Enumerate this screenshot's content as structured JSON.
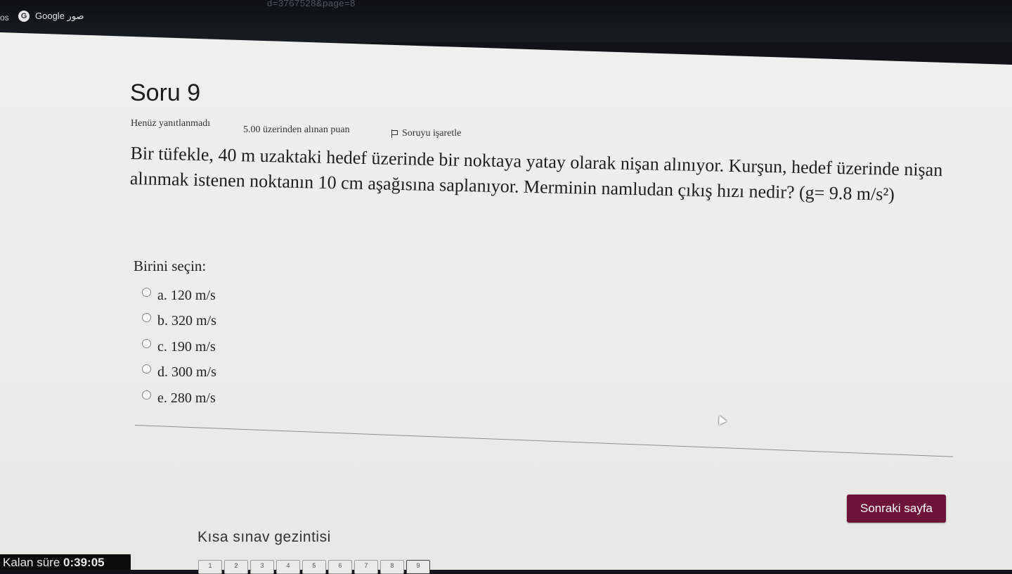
{
  "browser": {
    "url_fragment": "d=3767528&page=8",
    "tab_fragment": "os",
    "bookmark_label": "Google صور",
    "bookmark_icon": "google-icon"
  },
  "quiz": {
    "title": "Soru 9",
    "status": "Henüz yanıtlanmadı",
    "points": "5.00 üzerinden alınan puan",
    "flag_label": "Soruyu işaretle",
    "question_text": "Bir tüfekle, 40 m uzaktaki hedef üzerinde bir noktaya yatay olarak nişan alınıyor. Kurşun, hedef üzerinde nişan alınmak istenen noktanın 10 cm aşağısına saplanıyor. Merminin namludan çıkış hızı nedir? (g= 9.8 m/s²)",
    "choose_label": "Birini seçin:",
    "options": [
      {
        "label": "a. 120 m/s"
      },
      {
        "label": "b. 320 m/s"
      },
      {
        "label": "c. 190 m/s"
      },
      {
        "label": "d. 300 m/s"
      },
      {
        "label": "e. 280 m/s"
      }
    ],
    "next_button": "Sonraki sayfa"
  },
  "navigation": {
    "title": "Kısa sınav gezintisi",
    "timer_label": "Kalan süre",
    "timer_value": "0:39:05",
    "question_numbers": [
      "1",
      "2",
      "3",
      "4",
      "5",
      "6",
      "7",
      "8",
      "9"
    ]
  }
}
